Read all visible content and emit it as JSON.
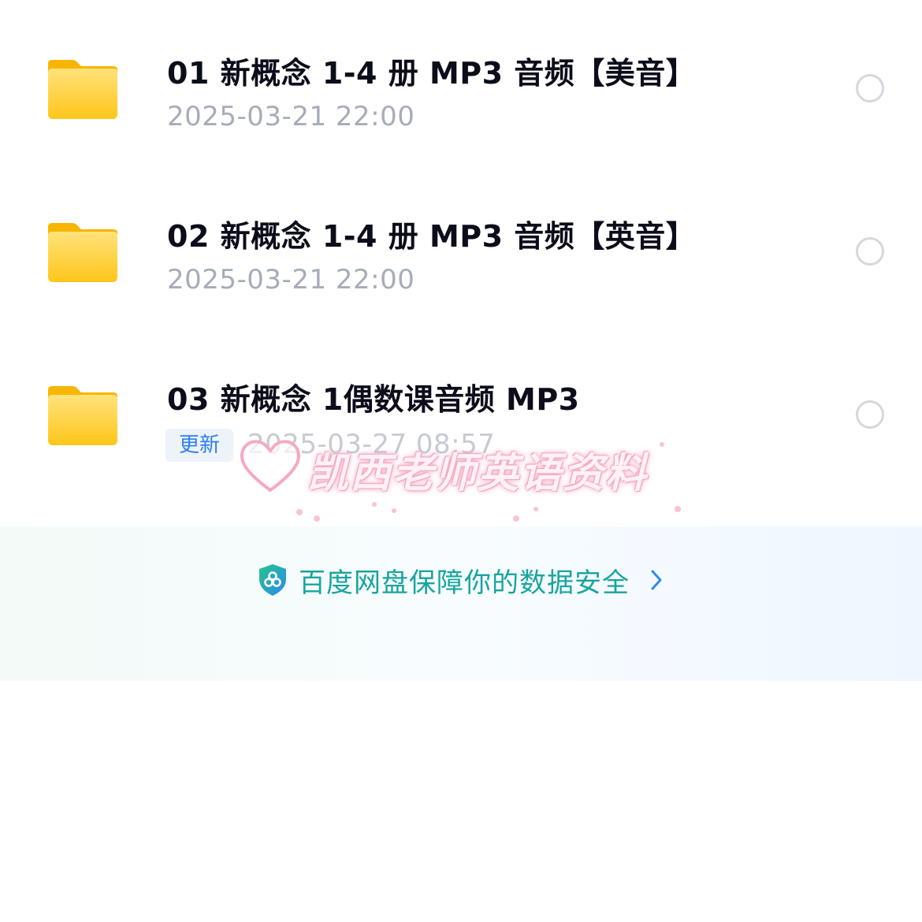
{
  "files": [
    {
      "name": "01 新概念 1-4 册 MP3 音频【美音】",
      "date": "2025-03-21 22:00",
      "badge": ""
    },
    {
      "name": "02 新概念 1-4 册 MP3 音频【英音】",
      "date": "2025-03-21 22:00",
      "badge": ""
    },
    {
      "name": "03 新概念 1偶数课音频 MP3",
      "date": "2025-03-27 08:57",
      "badge": "更新"
    }
  ],
  "footer": {
    "security_text": "百度网盘保障你的数据安全",
    "shield_icon": "shield-icon",
    "chevron_icon": "chevron-right-icon"
  },
  "watermark": {
    "text": "凯西老师英语资料",
    "heart_icon": "heart-icon"
  },
  "colors": {
    "folder": "#FFD23F",
    "title": "#0C0D1A",
    "date": "#A7ACB9",
    "badge_text": "#2C7FF0",
    "security_text": "#18A59F",
    "chevron": "#2C8CF0"
  }
}
